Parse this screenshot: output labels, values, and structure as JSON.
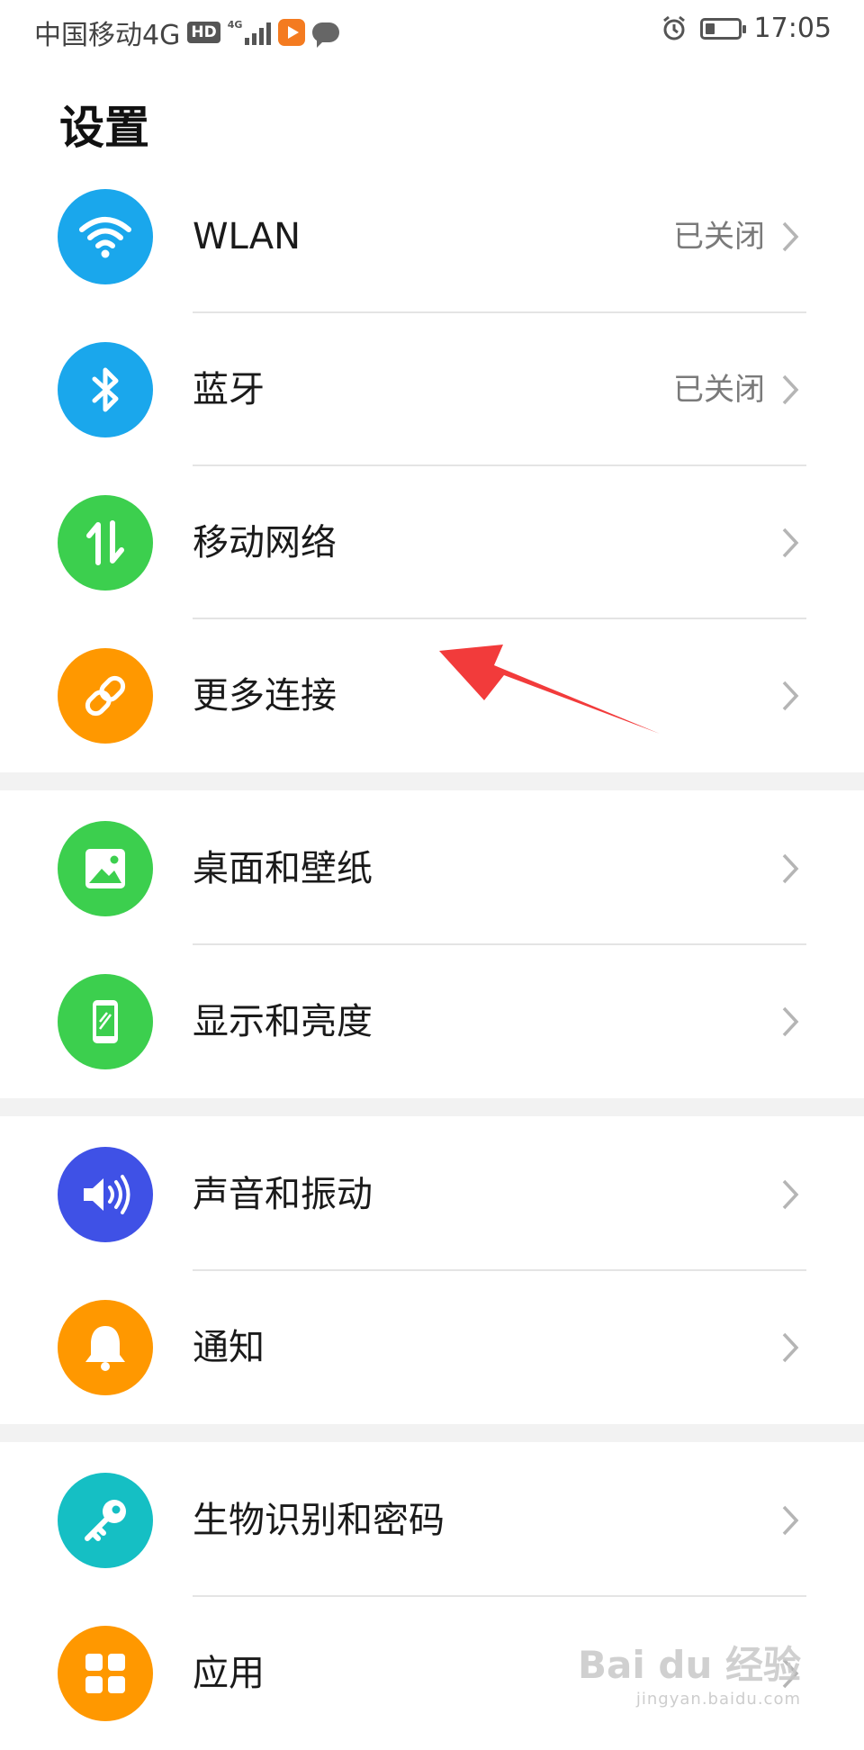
{
  "status_bar": {
    "carrier": "中国移动4G",
    "hd_badge": "HD",
    "network_tag": "4G",
    "time": "17:05",
    "battery_level": 0.3
  },
  "header": {
    "title": "设置"
  },
  "colors": {
    "wlan": "#1aa7ec",
    "bluetooth": "#1aa7ec",
    "mobile": "#3ccf4e",
    "more": "#ff9800",
    "wallpaper": "#3ccf4e",
    "display": "#3ccf4e",
    "sound": "#3f51e6",
    "notify": "#ff9800",
    "biometric": "#15bfc4",
    "apps": "#ff9800",
    "arrow": "#f23b3b"
  },
  "items": [
    {
      "label": "WLAN",
      "value": "已关闭",
      "icon": "wifi-icon"
    },
    {
      "label": "蓝牙",
      "value": "已关闭",
      "icon": "bluetooth-icon"
    },
    {
      "label": "移动网络",
      "value": "",
      "icon": "mobile-data-icon"
    },
    {
      "label": "更多连接",
      "value": "",
      "icon": "link-icon"
    },
    {
      "label": "桌面和壁纸",
      "value": "",
      "icon": "image-icon"
    },
    {
      "label": "显示和亮度",
      "value": "",
      "icon": "phone-screen-icon"
    },
    {
      "label": "声音和振动",
      "value": "",
      "icon": "speaker-icon"
    },
    {
      "label": "通知",
      "value": "",
      "icon": "bell-icon"
    },
    {
      "label": "生物识别和密码",
      "value": "",
      "icon": "key-icon"
    },
    {
      "label": "应用",
      "value": "",
      "icon": "apps-grid-icon"
    }
  ],
  "watermark": {
    "text": "Bai du 经验",
    "sub": "jingyan.baidu.com"
  }
}
